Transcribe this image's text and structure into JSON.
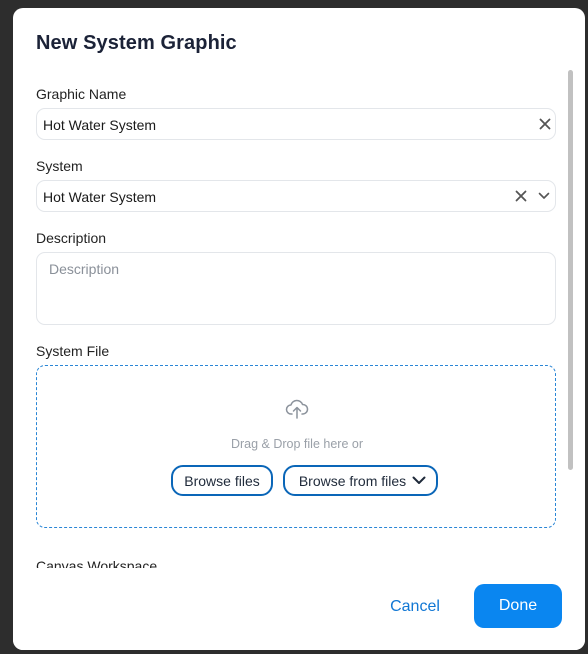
{
  "dialog": {
    "title": "New System Graphic"
  },
  "form": {
    "graphic_name": {
      "label": "Graphic Name",
      "value": "Hot Water System"
    },
    "system": {
      "label": "System",
      "value": "Hot Water System"
    },
    "description": {
      "label": "Description",
      "placeholder": "Description"
    },
    "system_file": {
      "label": "System File",
      "drop_text": "Drag & Drop file here or",
      "browse_files_label": "Browse files",
      "browse_from_files_label": "Browse from files"
    },
    "canvas_workspace": {
      "label": "Canvas Workspace"
    }
  },
  "footer": {
    "cancel_label": "Cancel",
    "done_label": "Done"
  },
  "icons": {
    "clear": "close-icon",
    "dropdown": "chevron-down-icon",
    "upload": "cloud-upload-icon"
  },
  "colors": {
    "primary": "#0a86f0",
    "link": "#1177d4",
    "dropzone_border": "#2a86d6"
  }
}
